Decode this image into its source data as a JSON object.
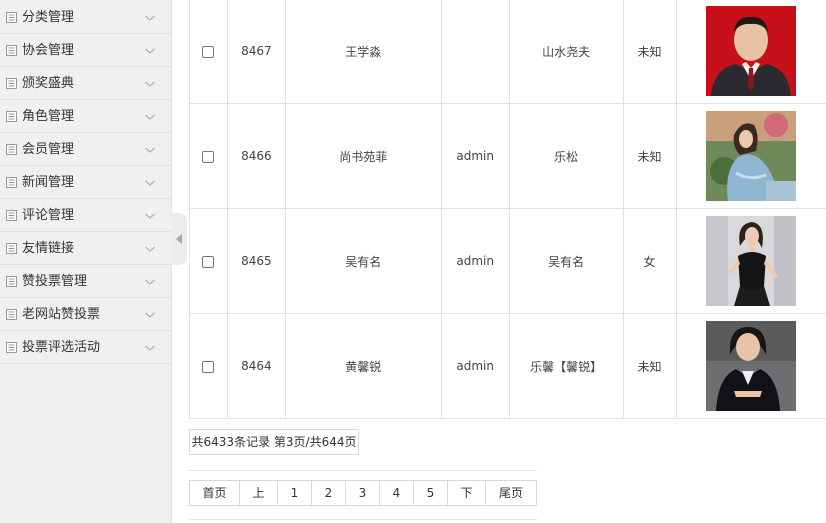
{
  "sidebar": {
    "items": [
      {
        "label": "分类管理"
      },
      {
        "label": "协会管理"
      },
      {
        "label": "颁奖盛典"
      },
      {
        "label": "角色管理"
      },
      {
        "label": "会员管理"
      },
      {
        "label": "新闻管理"
      },
      {
        "label": "评论管理"
      },
      {
        "label": "友情链接"
      },
      {
        "label": "赞投票管理"
      },
      {
        "label": "老网站赞投票"
      },
      {
        "label": "投票评选活动"
      }
    ]
  },
  "table": {
    "rows": [
      {
        "id": "8467",
        "name": "王学淼",
        "author": "",
        "editor": "山水尧夫",
        "gender": "未知",
        "photo": "man-in-suit-red-background"
      },
      {
        "id": "8466",
        "name": "尚书苑菲",
        "author": "admin",
        "editor": "乐松",
        "gender": "未知",
        "photo": "woman-in-blue-dress-outdoors"
      },
      {
        "id": "8465",
        "name": "吴有名",
        "author": "admin",
        "editor": "吴有名",
        "gender": "女",
        "photo": "woman-in-black-dress"
      },
      {
        "id": "8464",
        "name": "黄馨锐",
        "author": "admin",
        "editor": "乐馨【馨锐】",
        "gender": "未知",
        "photo": "woman-in-dark-suit"
      }
    ]
  },
  "pagination": {
    "record_info": "共6433条记录  第3页/共644页",
    "first": "首页",
    "prev": "上",
    "pages": [
      "1",
      "2",
      "3",
      "4",
      "5"
    ],
    "next": "下",
    "last": "尾页"
  },
  "colors": {
    "sidebar_bg": "#f0f0f0",
    "border": "#e2e2e2",
    "photo_red": "#c8101a"
  }
}
